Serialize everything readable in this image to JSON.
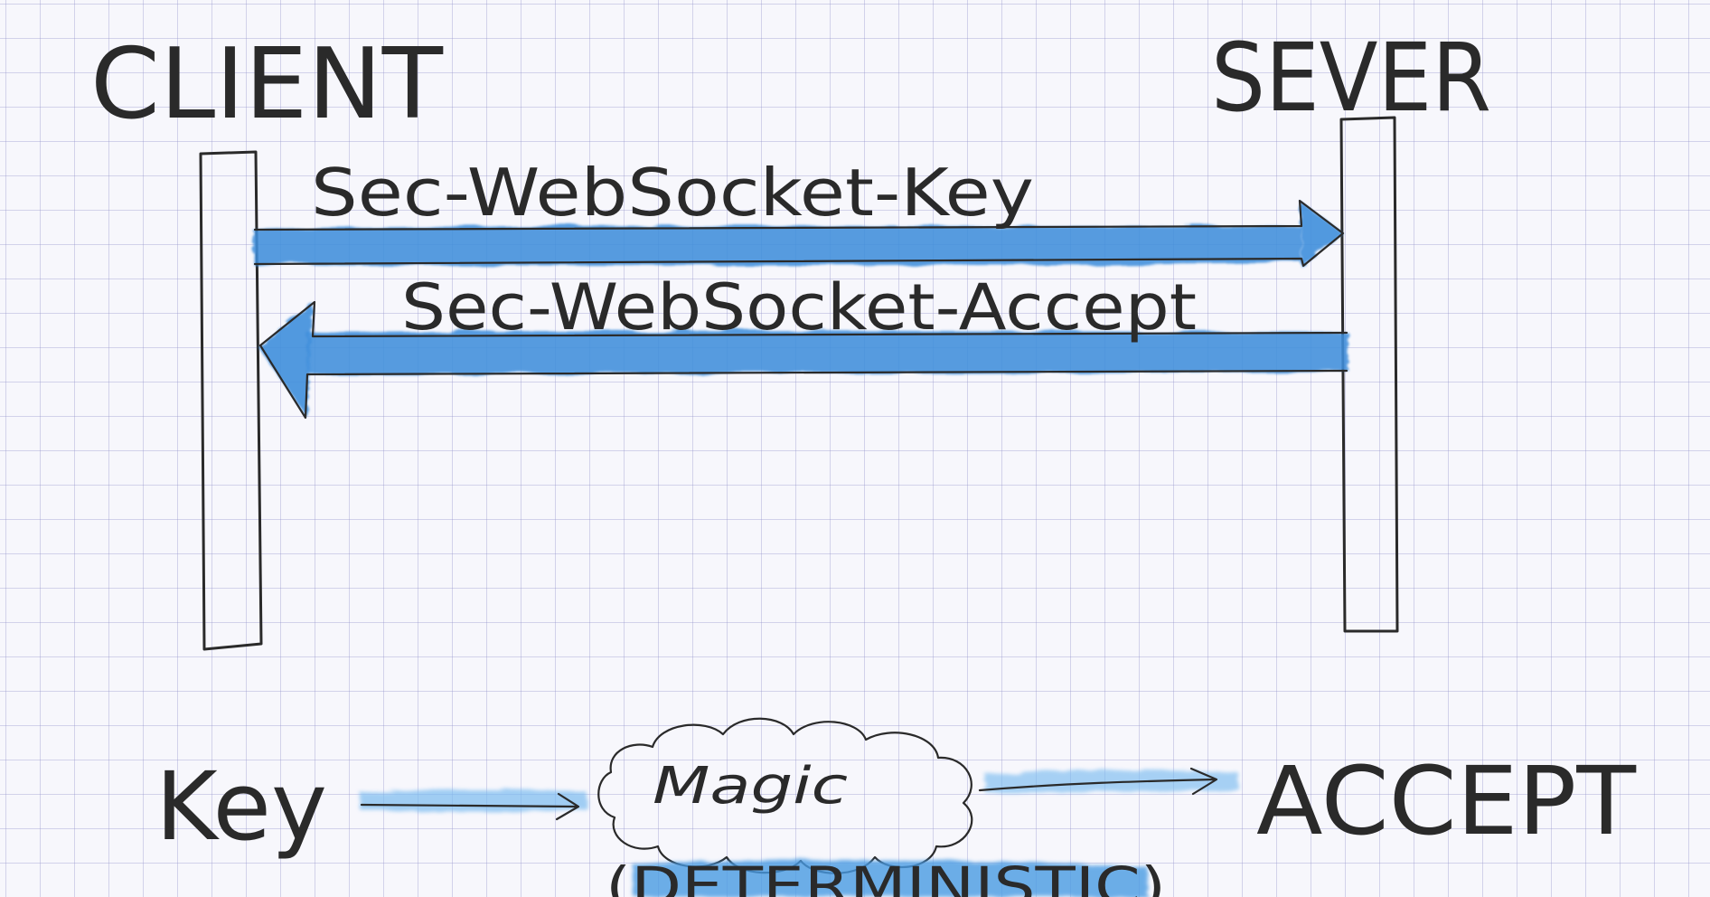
{
  "diagram": {
    "participants": {
      "client": "CLIENT",
      "server": "SEVER"
    },
    "messages": {
      "request": "Sec-WebSocket-Key",
      "response": "Sec-WebSocket-Accept"
    },
    "flow": {
      "input": "Key",
      "process": "Magic",
      "output": "ACCEPT",
      "note": "(DETERMINISTIC)"
    },
    "colors": {
      "watercolor": "#3f8fdc",
      "watercolor_light": "#7cbcf0",
      "ink": "#2a2a2a",
      "grid": "#9696cd"
    }
  }
}
